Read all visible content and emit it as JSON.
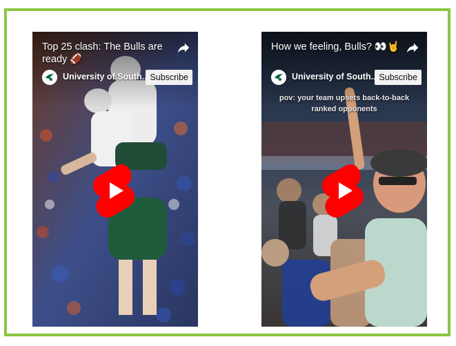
{
  "colors": {
    "border": "#8cc63f",
    "play_red": "#ff0000",
    "subscribe_bg": "#f2f2f2"
  },
  "shorts": [
    {
      "title": "Top 25 clash: The Bulls are ready 🏈",
      "channel": "University of South...",
      "subscribe_label": "Subscribe",
      "icons": [
        "share-icon",
        "channel-avatar-icon",
        "youtube-shorts-play-icon"
      ]
    },
    {
      "title": "How we feeling, Bulls? 👀🤘",
      "channel": "University of South...",
      "subscribe_label": "Subscribe",
      "overlay_caption": "pov: your team upsets back-to-back ranked opponents",
      "icons": [
        "share-icon",
        "channel-avatar-icon",
        "youtube-shorts-play-icon"
      ]
    }
  ]
}
